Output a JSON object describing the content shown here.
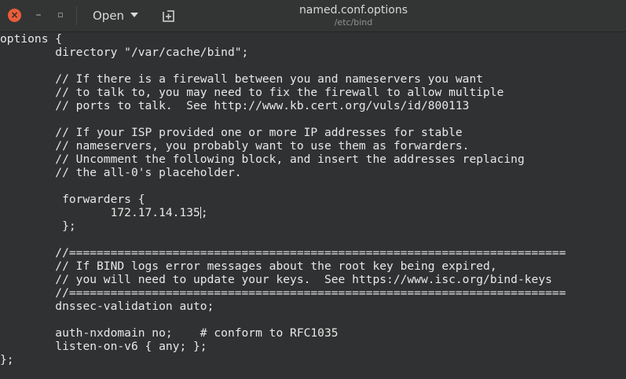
{
  "window": {
    "title": "named.conf.options",
    "subtitle": "/etc/bind"
  },
  "header": {
    "close_glyph": "×",
    "minimize_glyph": "–",
    "maximize_glyph": "▫",
    "open_label": "Open",
    "new_tab_icon": "new-document-icon"
  },
  "colors": {
    "background": "#2f3133",
    "header": "#333535",
    "close_button": "#ea5d3a",
    "text": "#e8e8e6"
  },
  "editor": {
    "cursor_line": 14,
    "cursor_after": "\t\t172.17.14.135",
    "lines": [
      "options {",
      "\tdirectory \"/var/cache/bind\";",
      "",
      "\t// If there is a firewall between you and nameservers you want",
      "\t// to talk to, you may need to fix the firewall to allow multiple",
      "\t// ports to talk.  See http://www.kb.cert.org/vuls/id/800113",
      "",
      "\t// If your ISP provided one or more IP addresses for stable",
      "\t// nameservers, you probably want to use them as forwarders.",
      "\t// Uncomment the following block, and insert the addresses replacing",
      "\t// the all-0's placeholder.",
      "",
      "\t forwarders {",
      "\t\t172.17.14.135;",
      "\t };",
      "",
      "\t//========================================================================",
      "\t// If BIND logs error messages about the root key being expired,",
      "\t// you will need to update your keys.  See https://www.isc.org/bind-keys",
      "\t//========================================================================",
      "\tdnssec-validation auto;",
      "",
      "\tauth-nxdomain no;    # conform to RFC1035",
      "\tlisten-on-v6 { any; };",
      "};"
    ]
  }
}
